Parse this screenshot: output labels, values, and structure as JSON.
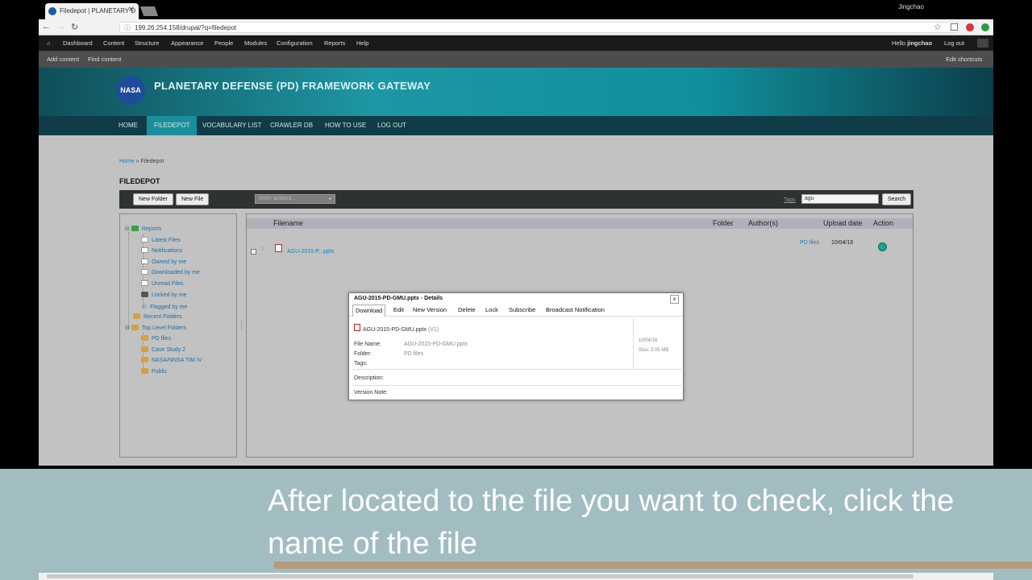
{
  "browser": {
    "tab_title": "Filedepot | PLANETARY D",
    "close_glyph": "✕",
    "profile_name": "Jingchao",
    "url": "199.26.254.158/drupal/?q=filedepot",
    "back_glyph": "←",
    "forward_glyph": "→",
    "reload_glyph": "↻",
    "star_glyph": "☆"
  },
  "admin_toolbar": {
    "items": [
      "Dashboard",
      "Content",
      "Structure",
      "Appearance",
      "People",
      "Modules",
      "Configuration",
      "Reports",
      "Help"
    ],
    "hello_prefix": "Hello ",
    "user": "jingchao",
    "logout": "Log out"
  },
  "shortcuts": {
    "add_content": "Add content",
    "find_content": "Find content",
    "edit_shortcuts": "Edit shortcuts"
  },
  "site": {
    "logo_text": "NASA",
    "title": "PLANETARY DEFENSE (PD) FRAMEWORK GATEWAY",
    "nav": [
      "HOME",
      "FILEDEPOT",
      "VOCABULARY LIST",
      "CRAWLER DB",
      "HOW TO USE",
      "LOG OUT"
    ],
    "active_nav": "FILEDEPOT"
  },
  "breadcrumb": {
    "home": "Home",
    "sep": " » ",
    "current": "Filedepot"
  },
  "filedepot": {
    "title": "FILEDEPOT",
    "new_folder": "New Folder",
    "new_file": "New File",
    "more_actions": "more actions...",
    "tags_label": "Tags",
    "search_value": "agu",
    "search_button": "Search"
  },
  "tree": {
    "reports": "Reports",
    "report_items": [
      "Latest Files",
      "Notifications",
      "Owned by me",
      "Downloaded by me",
      "Unread Files",
      "Locked by me",
      "Flagged by me"
    ],
    "recent_folders": "Recent Folders",
    "top_level_folders": "Top Level Folders",
    "folders": [
      "PD files",
      "Case Study 2",
      "NASA/NNSA TIM IV",
      "Public"
    ]
  },
  "file_list": {
    "headers": [
      "Filename",
      "Folder",
      "Author(s)",
      "Upload date",
      "Action"
    ],
    "rows": [
      {
        "filename": "AGU-2015-P...pptx",
        "folder": "PD files",
        "date": "10/04/16"
      }
    ]
  },
  "dialog": {
    "title": "AGU-2015-PD-GMU.pptx - Details",
    "close": "×",
    "tabs": [
      "Download",
      "Edit",
      "New Version",
      "Delete",
      "Lock",
      "Subscribe",
      "Broadcast Notification"
    ],
    "file_heading": "AGU-2015-PD-GMU.pptx",
    "version": "(V1)",
    "file_name_label": "File Name:",
    "file_name_value": "AGU-2015-PD-GMU.pptx",
    "folder_label": "Folder:",
    "folder_value": "PD files",
    "tags_label": "Tags:",
    "date": "10/04/16",
    "size": "Size: 3.05 MB",
    "description_label": "Description:",
    "version_note_label": "Version Note:"
  },
  "subtitle": {
    "text": "After located to the file you want to check, click the name of the file"
  }
}
